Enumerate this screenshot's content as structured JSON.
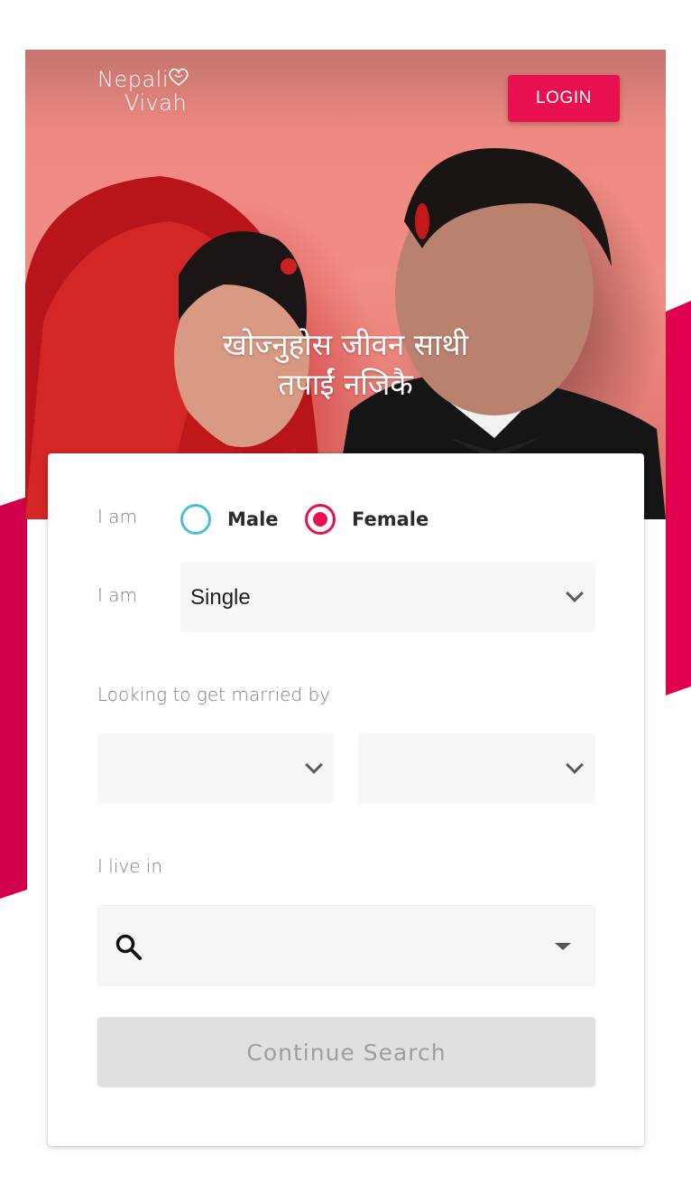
{
  "header": {
    "logo_line1": "Nepali",
    "logo_line2": "Vivah",
    "login_label": "LOGIN"
  },
  "hero": {
    "tagline_line1": "खोज्नुहोस जीवन साथी",
    "tagline_line2": "तपाईं नजिकै"
  },
  "form": {
    "gender_label": "I am",
    "gender_options": [
      "Male",
      "Female"
    ],
    "gender_selected": "Female",
    "status_label": "I am",
    "status_value": "Single",
    "married_by_label": "Looking to get married by",
    "married_by_month": "",
    "married_by_year": "",
    "live_in_label": "I live in",
    "live_in_value": "",
    "continue_label": "Continue Search"
  },
  "colors": {
    "accent": "#e8104f",
    "radio_unselected": "#4cbcd8",
    "button_disabled": "#e0e0e0"
  },
  "icons": {
    "search": "search-icon",
    "chevron": "chevron-down-icon",
    "dropdown": "caret-down-icon"
  }
}
